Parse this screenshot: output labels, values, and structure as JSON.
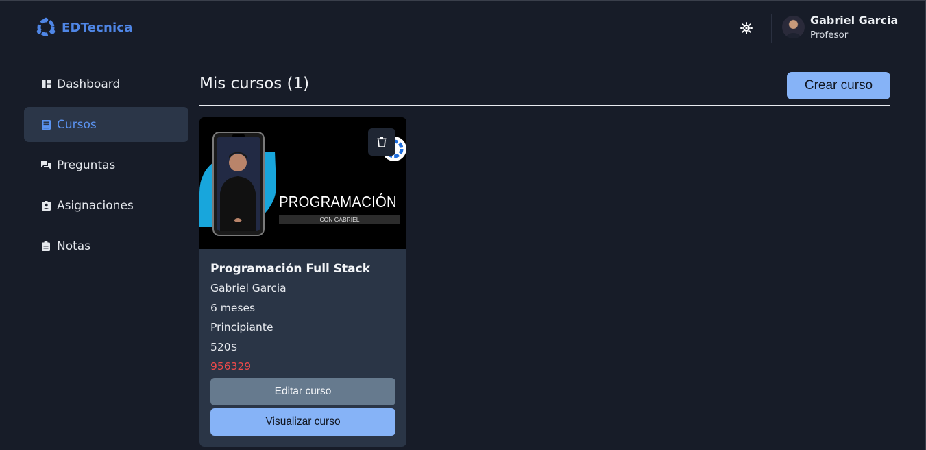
{
  "app": {
    "brand": "EDTecnica",
    "brand_color": "#4f86e6"
  },
  "header": {
    "theme_toggle_icon": "sun-icon",
    "user": {
      "name": "Gabriel Garcia",
      "role": "Profesor"
    }
  },
  "sidebar": {
    "items": [
      {
        "label": "Dashboard",
        "icon": "dashboard-icon",
        "active": false
      },
      {
        "label": "Cursos",
        "icon": "book-icon",
        "active": true
      },
      {
        "label": "Preguntas",
        "icon": "chat-bubbles-icon",
        "active": false
      },
      {
        "label": "Asignaciones",
        "icon": "assignment-ind-icon",
        "active": false
      },
      {
        "label": "Notas",
        "icon": "clipboard-icon",
        "active": false
      }
    ]
  },
  "main": {
    "title": "Mis cursos (1)",
    "create_button": "Crear curso",
    "courses": [
      {
        "thumbnail": {
          "headline": "PROGRAMACIÓN",
          "subline": "CON GABRIEL"
        },
        "title": "Programación Full Stack",
        "instructor": "Gabriel Garcia",
        "duration": "6 meses",
        "level": "Principiante",
        "price": "520$",
        "code": "956329",
        "edit_button": "Editar curso",
        "view_button": "Visualizar curso"
      }
    ]
  },
  "colors": {
    "background": "#171c28",
    "accent": "#86b3f7",
    "active_nav": "#5b93f0",
    "code_red": "#f04a4a"
  }
}
